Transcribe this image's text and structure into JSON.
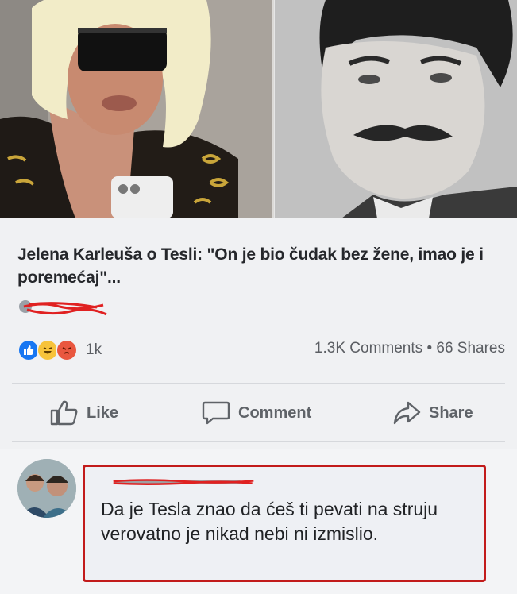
{
  "post": {
    "title": "Jelena Karleuša o Tesli: \"On je bio čudak bez žene, imao je i poremećaj\"..."
  },
  "reactions": {
    "icons": [
      "like-icon",
      "haha-icon",
      "angry-icon"
    ],
    "count": "1k"
  },
  "stats": {
    "comments": "1.3K Comments",
    "separator": "•",
    "shares": "66 Shares"
  },
  "actions": {
    "like": "Like",
    "comment": "Comment",
    "share": "Share"
  },
  "comment": {
    "text": "Da je Tesla znao da ćeš ti pevati na struju verovatno je nikad nebi ni izmislio."
  },
  "colors": {
    "highlight_border": "#c21b1b",
    "like_blue": "#1877f2",
    "angry_red": "#e9573f",
    "haha_yellow": "#f7c33b"
  }
}
